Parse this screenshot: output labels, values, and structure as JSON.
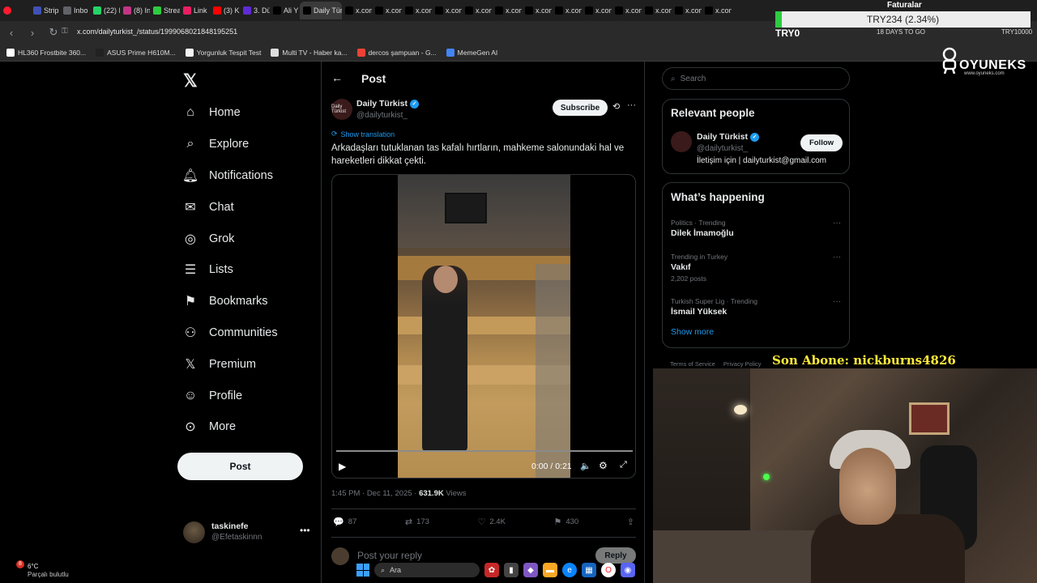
{
  "browser": {
    "tabs": [
      {
        "label": "Strip",
        "color": "#3f51b5"
      },
      {
        "label": "Inbo",
        "color": "#5f6368"
      },
      {
        "label": "(22) I",
        "color": "#25d366"
      },
      {
        "label": "(8) In",
        "color": "#c13584"
      },
      {
        "label": "Strea",
        "color": "#2ecc40"
      },
      {
        "label": "Link",
        "color": "#e91e63"
      },
      {
        "label": "(3) K",
        "color": "#ff0000"
      },
      {
        "label": "3. Dü",
        "color": "#5f2bd6"
      },
      {
        "label": "Ali Y",
        "color": "#000000"
      },
      {
        "label": "Daily Türk",
        "color": "#000000",
        "active": true
      },
      {
        "label": "x.com",
        "color": "#000000"
      },
      {
        "label": "x.con",
        "color": "#000000"
      },
      {
        "label": "x.con",
        "color": "#000000"
      },
      {
        "label": "x.con",
        "color": "#000000"
      },
      {
        "label": "x.con",
        "color": "#000000"
      },
      {
        "label": "x.con",
        "color": "#000000"
      },
      {
        "label": "x.con",
        "color": "#000000"
      },
      {
        "label": "x.con",
        "color": "#000000"
      },
      {
        "label": "x.con",
        "color": "#000000"
      },
      {
        "label": "x.con",
        "color": "#000000"
      },
      {
        "label": "x.con",
        "color": "#000000"
      },
      {
        "label": "x.con",
        "color": "#000000"
      },
      {
        "label": "x.con",
        "color": "#000000"
      }
    ],
    "url": "x.com/dailyturkist_/status/1999068021848195251",
    "bookmarks": [
      {
        "label": "HL360 Frostbite 360...",
        "color": "#ffffff"
      },
      {
        "label": "ASUS Prime H610M...",
        "color": "#222222"
      },
      {
        "label": "Yorgunluk Tespit Test",
        "color": "#f5f5f5"
      },
      {
        "label": "Multi TV - Haber ka...",
        "color": "#dddddd"
      },
      {
        "label": "dercos şampuan - G...",
        "color": "#ea4335"
      },
      {
        "label": "MemeGen AI",
        "color": "#4285f4"
      }
    ]
  },
  "overlay": {
    "ticker": "TRY234 (2.34%)",
    "ticker_code": "TRY0",
    "faturalar": "Faturalar",
    "days_to_go": "18 DAYS TO GO",
    "try_right": "TRY10000",
    "brand": "OYUNEKS",
    "brand_sub": "www.oyuneks.com",
    "son_abone": "Son Abone: nickburns4826"
  },
  "left_nav": {
    "items": [
      {
        "label": "Home",
        "icon": "home-icon"
      },
      {
        "label": "Explore",
        "icon": "search-icon"
      },
      {
        "label": "Notifications",
        "icon": "bell-icon"
      },
      {
        "label": "Chat",
        "icon": "mail-icon"
      },
      {
        "label": "Grok",
        "icon": "grok-icon"
      },
      {
        "label": "Lists",
        "icon": "list-icon"
      },
      {
        "label": "Bookmarks",
        "icon": "bookmark-icon"
      },
      {
        "label": "Communities",
        "icon": "people-icon"
      },
      {
        "label": "Premium",
        "icon": "x-icon"
      },
      {
        "label": "Profile",
        "icon": "person-icon"
      },
      {
        "label": "More",
        "icon": "more-circle-icon"
      }
    ],
    "post_label": "Post",
    "account": {
      "name": "taskinefe",
      "handle": "@Efetaskinnn"
    }
  },
  "post": {
    "header_title": "Post",
    "author_name": "Daily Türkist",
    "author_handle": "@dailyturkist_",
    "avatar_text": "Daily Türkist",
    "subscribe_label": "Subscribe",
    "show_translation": "Show translation",
    "text": "Arkadaşları tutuklanan tas kafalı hırtların, mahkeme salonundaki hal ve hareketleri dikkat çekti.",
    "video_time": "0:00 / 0:21",
    "video_progress": 0,
    "timestamp": "1:45 PM · Dec 11, 2025 · ",
    "views_count": "631.9K",
    "views_label": " Views",
    "replies": "87",
    "reposts": "173",
    "likes": "2.4K",
    "bookmarks": "430",
    "reply_placeholder": "Post your reply",
    "reply_button": "Reply"
  },
  "right": {
    "search_placeholder": "Search",
    "relevant_title": "Relevant people",
    "relevant": {
      "name": "Daily Türkist",
      "handle": "@dailyturkist_",
      "bio": "İletişim için | dailyturkist@gmail.com",
      "follow_label": "Follow"
    },
    "happening_title": "What’s happening",
    "trends": [
      {
        "context": "Politics · Trending",
        "topic": "Dilek İmamoğlu",
        "count": ""
      },
      {
        "context": "Trending in Turkey",
        "topic": "Vakıf",
        "count": "2,202 posts"
      },
      {
        "context": "Turkish Super Lig · Trending",
        "topic": "İsmail Yüksek",
        "count": ""
      }
    ],
    "show_more": "Show more",
    "footer": [
      "Terms of Service",
      "Privacy Policy"
    ]
  },
  "taskbar": {
    "weather_badge": "8",
    "temperature": "6°C",
    "condition": "Parçalı bulutlu",
    "search_label": "Ara"
  }
}
